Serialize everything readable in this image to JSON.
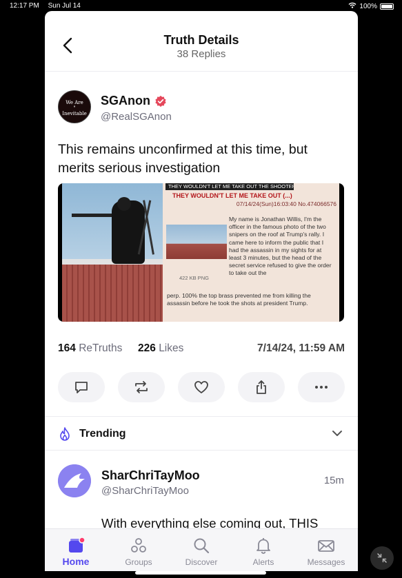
{
  "status_bar": {
    "time": "12:17 PM",
    "date": "Sun Jul 14",
    "battery": "100%"
  },
  "header": {
    "title": "Truth Details",
    "subtitle": "38 Replies"
  },
  "post": {
    "display_name": "SGAnon",
    "handle": "@RealSGAnon",
    "avatar_text": {
      "line1": "We Are",
      "line2": "\"",
      "line3": "Inevitable"
    },
    "text": "This remains unconfirmed at this time, but merits serious investigation",
    "media": {
      "banner": "THEY WOULDN'T LET ME TAKE OUT THE SHOOTER",
      "title": "THEY WOULDN'T LET ME TAKE OUT (...)",
      "meta": "07/14/24(Sun)16:03:40 No.474066576",
      "file_size": "422 KB PNG",
      "body": "My name is Jonathan Willis, I'm the officer in the famous photo of the two snipers on the roof at Trump's rally. I came here to inform the public that I had the assassin in my sights for at least 3 minutes, but the head of the secret service refused to give the order to take out the",
      "body_cont": "perp. 100% the top brass prevented me from killing the assassin before he took the shots at president Trump."
    },
    "stats": {
      "retruths_count": "164",
      "retruths_label": "ReTruths",
      "likes_count": "226",
      "likes_label": "Likes",
      "timestamp": "7/14/24, 11:59 AM"
    }
  },
  "actions": [
    "reply-icon",
    "retruth-icon",
    "like-icon",
    "share-icon",
    "more-icon"
  ],
  "trending": {
    "label": "Trending"
  },
  "trending_post": {
    "display_name": "SharChriTayMoo",
    "handle": "@SharChriTayMoo",
    "time": "15m",
    "text": "With everything else coming out, THIS"
  },
  "tabbar": {
    "home": "Home",
    "groups": "Groups",
    "discover": "Discover",
    "alerts": "Alerts",
    "messages": "Messages"
  },
  "colors": {
    "accent": "#5448ee",
    "verified": "#e5475b",
    "background": "#ffffff"
  }
}
